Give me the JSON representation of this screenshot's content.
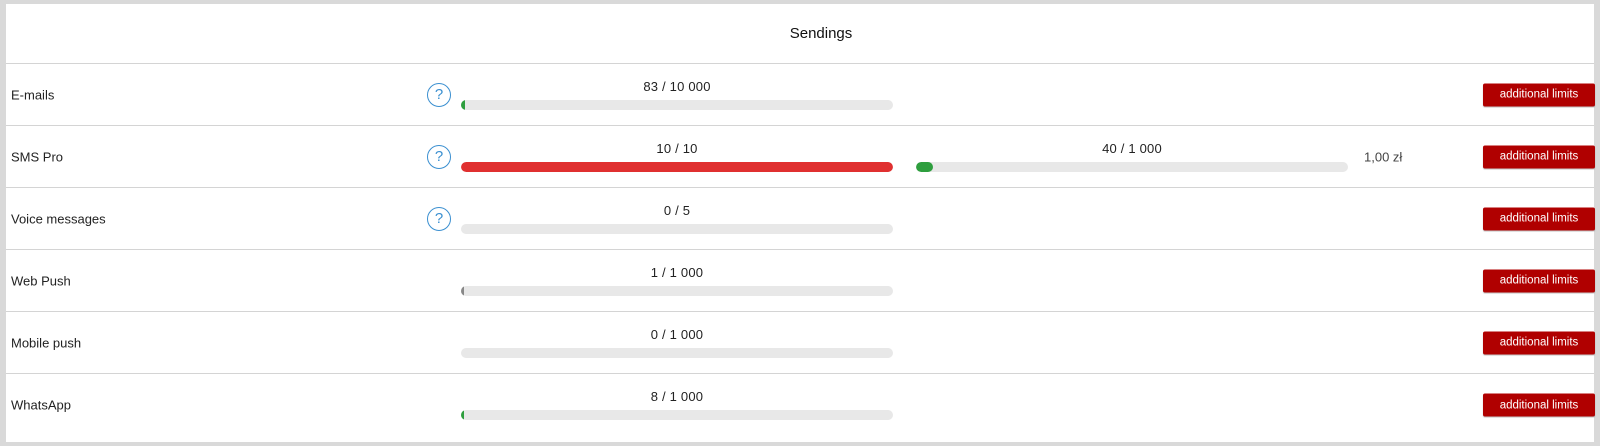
{
  "title": "Sendings",
  "button_label": "additional limits",
  "rows": [
    {
      "label": "E-mails",
      "help": true,
      "meters": [
        {
          "used": "83",
          "limit": "10 000",
          "fraction": 0.0083,
          "color": "#2e9e3e"
        }
      ],
      "price": ""
    },
    {
      "label": "SMS Pro",
      "help": true,
      "meters": [
        {
          "used": "10",
          "limit": "10",
          "fraction": 1.0,
          "color": "#e03030"
        },
        {
          "used": "40",
          "limit": "1 000",
          "fraction": 0.04,
          "color": "#2e9e3e"
        }
      ],
      "price": "1,00 zł"
    },
    {
      "label": "Voice messages",
      "help": true,
      "meters": [
        {
          "used": "0",
          "limit": "5",
          "fraction": 0,
          "color": "#2e9e3e"
        }
      ],
      "price": ""
    },
    {
      "label": "Web Push",
      "help": false,
      "meters": [
        {
          "used": "1",
          "limit": "1 000",
          "fraction": 0.001,
          "color": "#888888"
        }
      ],
      "price": ""
    },
    {
      "label": "Mobile push",
      "help": false,
      "meters": [
        {
          "used": "0",
          "limit": "1 000",
          "fraction": 0,
          "color": "#2e9e3e"
        }
      ],
      "price": ""
    },
    {
      "label": "WhatsApp",
      "help": false,
      "meters": [
        {
          "used": "8",
          "limit": "1 000",
          "fraction": 0.008,
          "color": "#2e9e3e"
        }
      ],
      "price": ""
    }
  ]
}
